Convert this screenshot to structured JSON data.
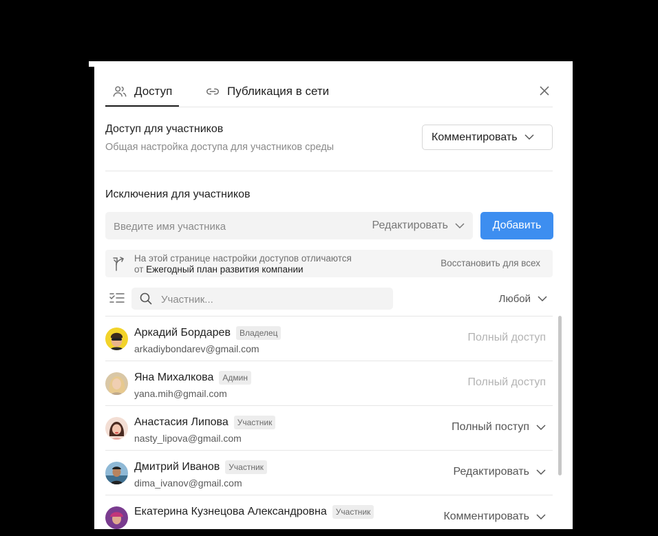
{
  "tabs": {
    "access_label": "Доступ",
    "publish_label": "Публикация в сети"
  },
  "participants_access": {
    "title": "Доступ для участников",
    "subtitle": "Общая настройка доступа для участников среды",
    "selected": "Комментировать"
  },
  "exceptions": {
    "title": "Исключения для участников",
    "name_placeholder": "Введите имя участника",
    "role_selected": "Редактировать",
    "add_label": "Добавить"
  },
  "notice": {
    "line1": "На этой странице настройки доступов отличаются",
    "prefix": "от ",
    "source": "Ежегодный план развития компании",
    "restore_label": "Восстановить для всех"
  },
  "filter": {
    "search_placeholder": "Участник...",
    "any_label": "Любой"
  },
  "members": [
    {
      "name": "Аркадий Бордарев",
      "badge": "Владелец",
      "email": "arkadiybondarev@gmail.com",
      "access": "Полный доступ",
      "editable": false
    },
    {
      "name": "Яна Михалкова",
      "badge": "Админ",
      "email": "yana.mih@gmail.com",
      "access": "Полный доступ",
      "editable": false
    },
    {
      "name": "Анастасия Липова",
      "badge": "Участник",
      "email": "nasty_lipova@gmail.com",
      "access": "Полный поступ",
      "editable": true
    },
    {
      "name": "Дмитрий Иванов",
      "badge": "Участник",
      "email": "dima_ivanov@gmail.com",
      "access": "Редактировать",
      "editable": true
    },
    {
      "name": "Екатерина Кузнецова Александровна",
      "badge": "Участник",
      "email": "",
      "access": "Комментировать",
      "editable": true
    }
  ],
  "colors": {
    "accent": "#3d8ef0"
  }
}
